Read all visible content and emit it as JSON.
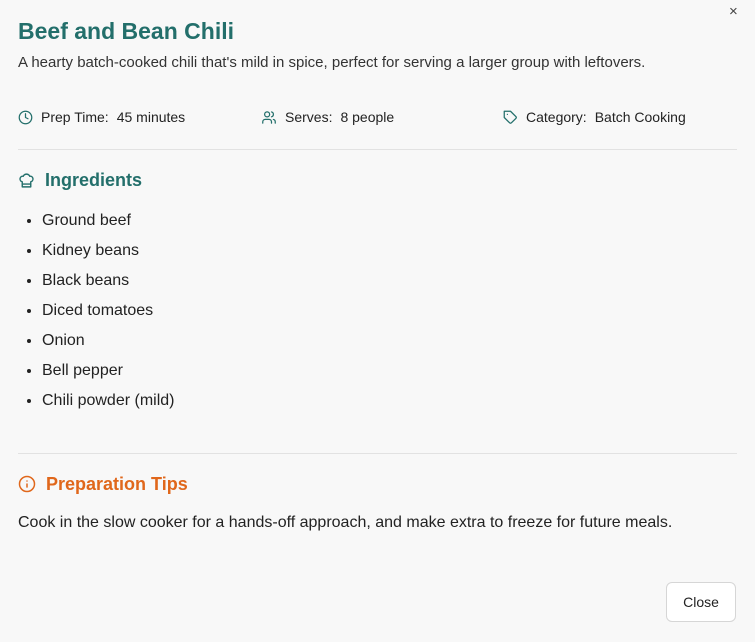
{
  "recipe": {
    "title": "Beef and Bean Chili",
    "description": "A hearty batch-cooked chili that's mild in spice, perfect for serving a larger group with leftovers.",
    "meta": {
      "prep_label": "Prep Time:",
      "prep_value": "45 minutes",
      "serves_label": "Serves:",
      "serves_value": "8 people",
      "category_label": "Category:",
      "category_value": "Batch Cooking"
    },
    "ingredients_heading": "Ingredients",
    "ingredients": [
      "Ground beef",
      "Kidney beans",
      "Black beans",
      "Diced tomatoes",
      "Onion",
      "Bell pepper",
      "Chili powder (mild)"
    ],
    "tips_heading": "Preparation Tips",
    "tips_text": "Cook in the slow cooker for a hands-off approach, and make extra to freeze for future meals."
  },
  "dialog": {
    "close_icon": "×",
    "close_label": "Close"
  },
  "icons": {
    "prep": "clock-icon",
    "serves": "users-icon",
    "category": "tag-icon",
    "ingredients": "chef-hat-icon",
    "tips": "info-icon"
  },
  "colors": {
    "primary": "#236f6b",
    "accent": "#e0671b",
    "background": "#f8f8f8"
  }
}
